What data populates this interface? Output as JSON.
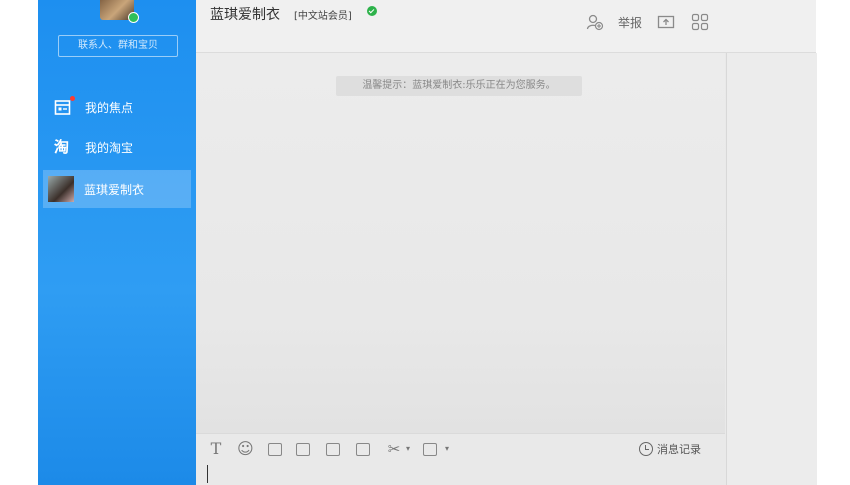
{
  "sidebar": {
    "search_placeholder": "联系人、群和宝贝",
    "items": [
      {
        "label": "我的焦点",
        "icon": "calendar-icon"
      },
      {
        "label": "我的淘宝",
        "icon": "taobao-icon",
        "glyph": "淘"
      },
      {
        "label": "蓝琪爱制衣",
        "icon": "shop-avatar"
      }
    ]
  },
  "header": {
    "shop_name": "蓝琪爱制衣",
    "member_badge": "[中文站会员]",
    "report_label": "举报"
  },
  "chat": {
    "tip": "温馨提示：蓝琪爱制衣:乐乐正在为您服务。"
  },
  "toolbar": {
    "history_label": "消息记录",
    "font_glyph": "T",
    "emoji_glyph": "☺",
    "scissors_glyph": "✂"
  },
  "colors": {
    "sidebar": "#1d8ff0",
    "online": "#2fbf5a",
    "verified": "#2db24a"
  }
}
